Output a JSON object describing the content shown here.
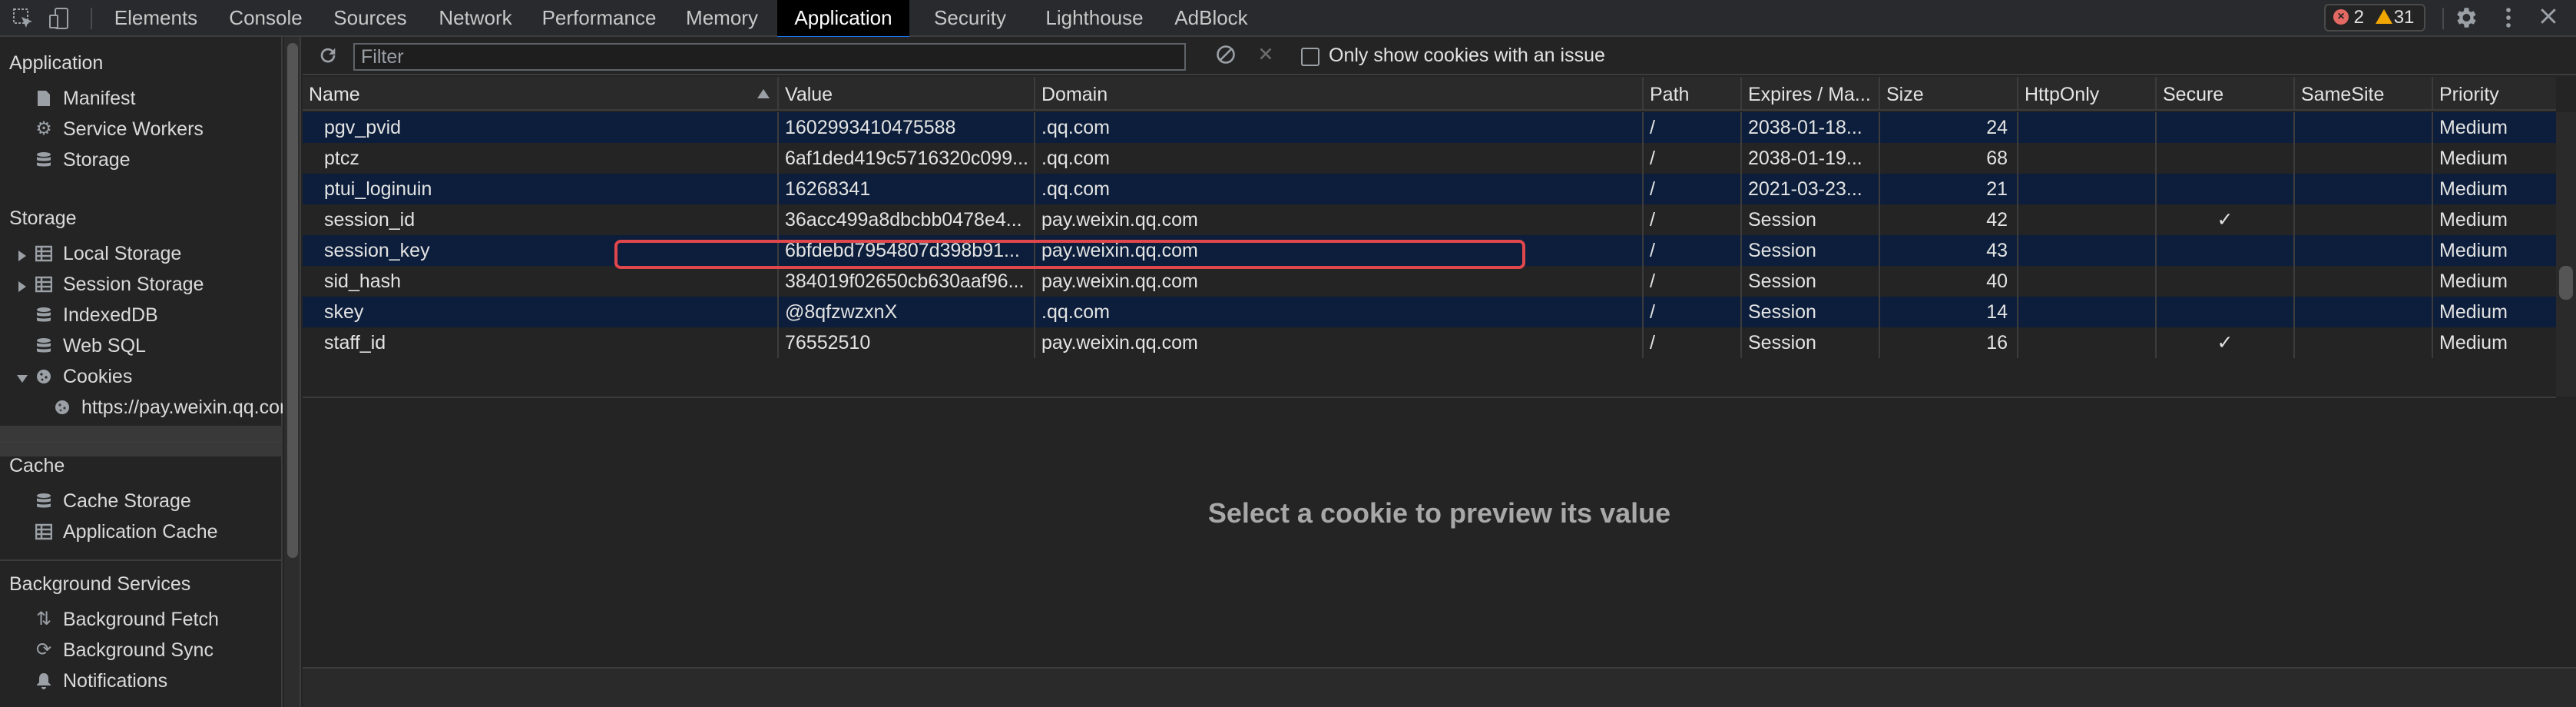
{
  "toolbar": {
    "tabs": [
      "Elements",
      "Console",
      "Sources",
      "Network",
      "Performance",
      "Memory",
      "Application",
      "Security",
      "Lighthouse",
      "AdBlock"
    ],
    "active_tab": "Application",
    "errors_count": "2",
    "warnings_count": "31"
  },
  "sidebar": {
    "application": {
      "title": "Application",
      "items": [
        "Manifest",
        "Service Workers",
        "Storage"
      ]
    },
    "storage": {
      "title": "Storage",
      "items": [
        "Local Storage",
        "Session Storage",
        "IndexedDB",
        "Web SQL",
        "Cookies"
      ],
      "cookie_origin": "https://pay.weixin.qq.com"
    },
    "cache": {
      "title": "Cache",
      "items": [
        "Cache Storage",
        "Application Cache"
      ]
    },
    "background": {
      "title": "Background Services",
      "items": [
        "Background Fetch",
        "Background Sync",
        "Notifications"
      ]
    }
  },
  "cookies_toolbar": {
    "filter_placeholder": "Filter",
    "only_issues_label": "Only show cookies with an issue"
  },
  "table": {
    "headers": [
      "Name",
      "Value",
      "Domain",
      "Path",
      "Expires / Ma...",
      "Size",
      "HttpOnly",
      "Secure",
      "SameSite",
      "Priority"
    ],
    "rows": [
      {
        "name": "pgv_pvid",
        "value": "1602993410475588",
        "domain": ".qq.com",
        "path": "/",
        "expires": "2038-01-18...",
        "size": "24",
        "httponly": "",
        "secure": "",
        "samesite": "",
        "priority": "Medium"
      },
      {
        "name": "ptcz",
        "value": "6af1ded419c5716320c099...",
        "domain": ".qq.com",
        "path": "/",
        "expires": "2038-01-19...",
        "size": "68",
        "httponly": "",
        "secure": "",
        "samesite": "",
        "priority": "Medium"
      },
      {
        "name": "ptui_loginuin",
        "value": "16268341",
        "domain": ".qq.com",
        "path": "/",
        "expires": "2021-03-23...",
        "size": "21",
        "httponly": "",
        "secure": "",
        "samesite": "",
        "priority": "Medium"
      },
      {
        "name": "session_id",
        "value": "36acc499a8dbcbb0478e4...",
        "domain": "pay.weixin.qq.com",
        "path": "/",
        "expires": "Session",
        "size": "42",
        "httponly": "",
        "secure": "✓",
        "samesite": "",
        "priority": "Medium"
      },
      {
        "name": "session_key",
        "value": "6bfdebd7954807d398b91...",
        "domain": "pay.weixin.qq.com",
        "path": "/",
        "expires": "Session",
        "size": "43",
        "httponly": "",
        "secure": "",
        "samesite": "",
        "priority": "Medium"
      },
      {
        "name": "sid_hash",
        "value": "384019f02650cb630aaf96...",
        "domain": "pay.weixin.qq.com",
        "path": "/",
        "expires": "Session",
        "size": "40",
        "httponly": "",
        "secure": "",
        "samesite": "",
        "priority": "Medium"
      },
      {
        "name": "skey",
        "value": "@8qfzwzxnX",
        "domain": ".qq.com",
        "path": "/",
        "expires": "Session",
        "size": "14",
        "httponly": "",
        "secure": "",
        "samesite": "",
        "priority": "Medium"
      },
      {
        "name": "staff_id",
        "value": "76552510",
        "domain": "pay.weixin.qq.com",
        "path": "/",
        "expires": "Session",
        "size": "16",
        "httponly": "",
        "secure": "✓",
        "samesite": "",
        "priority": "Medium"
      }
    ]
  },
  "preview": {
    "message": "Select a cookie to preview its value"
  },
  "colors": {
    "accent": "#1a73e8",
    "highlight_border": "#e0474c",
    "odd_row": "#0c1e3b",
    "background": "#242424"
  }
}
